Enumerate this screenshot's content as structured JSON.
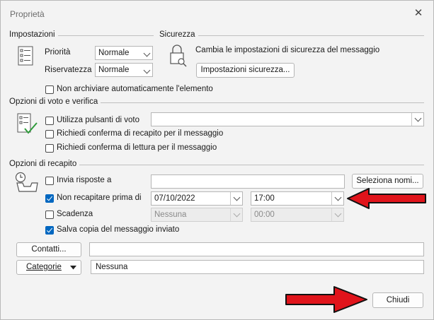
{
  "dialog": {
    "title": "Proprietà",
    "close_glyph": "✕"
  },
  "impostazioni": {
    "heading": "Impostazioni",
    "priority_label": "Priorità",
    "priority_value": "Normale",
    "confidentiality_label": "Riservatezza",
    "confidentiality_value": "Normale",
    "no_archive_label": "Non archiviare automaticamente l'elemento",
    "no_archive_checked": false
  },
  "sicurezza": {
    "heading": "Sicurezza",
    "description": "Cambia le impostazioni di sicurezza del messaggio",
    "button_label": "Impostazioni sicurezza..."
  },
  "voto": {
    "heading": "Opzioni di voto e verifica",
    "use_voting_label": "Utilizza pulsanti di voto",
    "use_voting_checked": false,
    "voting_value": "",
    "delivery_receipt_label": "Richiedi conferma di recapito per il messaggio",
    "delivery_receipt_checked": false,
    "read_receipt_label": "Richiedi conferma di lettura per il messaggio",
    "read_receipt_checked": false
  },
  "recapito": {
    "heading": "Opzioni di recapito",
    "reply_to_label": "Invia risposte a",
    "reply_to_checked": false,
    "reply_to_value": "",
    "select_names_label": "Seleziona nomi...",
    "do_not_deliver_label": "Non recapitare prima di",
    "do_not_deliver_checked": true,
    "deliver_date": "07/10/2022",
    "deliver_time": "17:00",
    "expires_label": "Scadenza",
    "expires_checked": false,
    "expires_date": "Nessuna",
    "expires_time": "00:00",
    "save_copy_label": "Salva copia del messaggio inviato",
    "save_copy_checked": true
  },
  "contacts": {
    "button_label": "Contatti...",
    "value": ""
  },
  "categories": {
    "button_label": "Categorie",
    "value": "Nessuna"
  },
  "footer": {
    "close_label": "Chiudi"
  },
  "colors": {
    "accent": "#0067c0",
    "arrow_fill": "#e0141b",
    "background": "#f3f3f3"
  }
}
